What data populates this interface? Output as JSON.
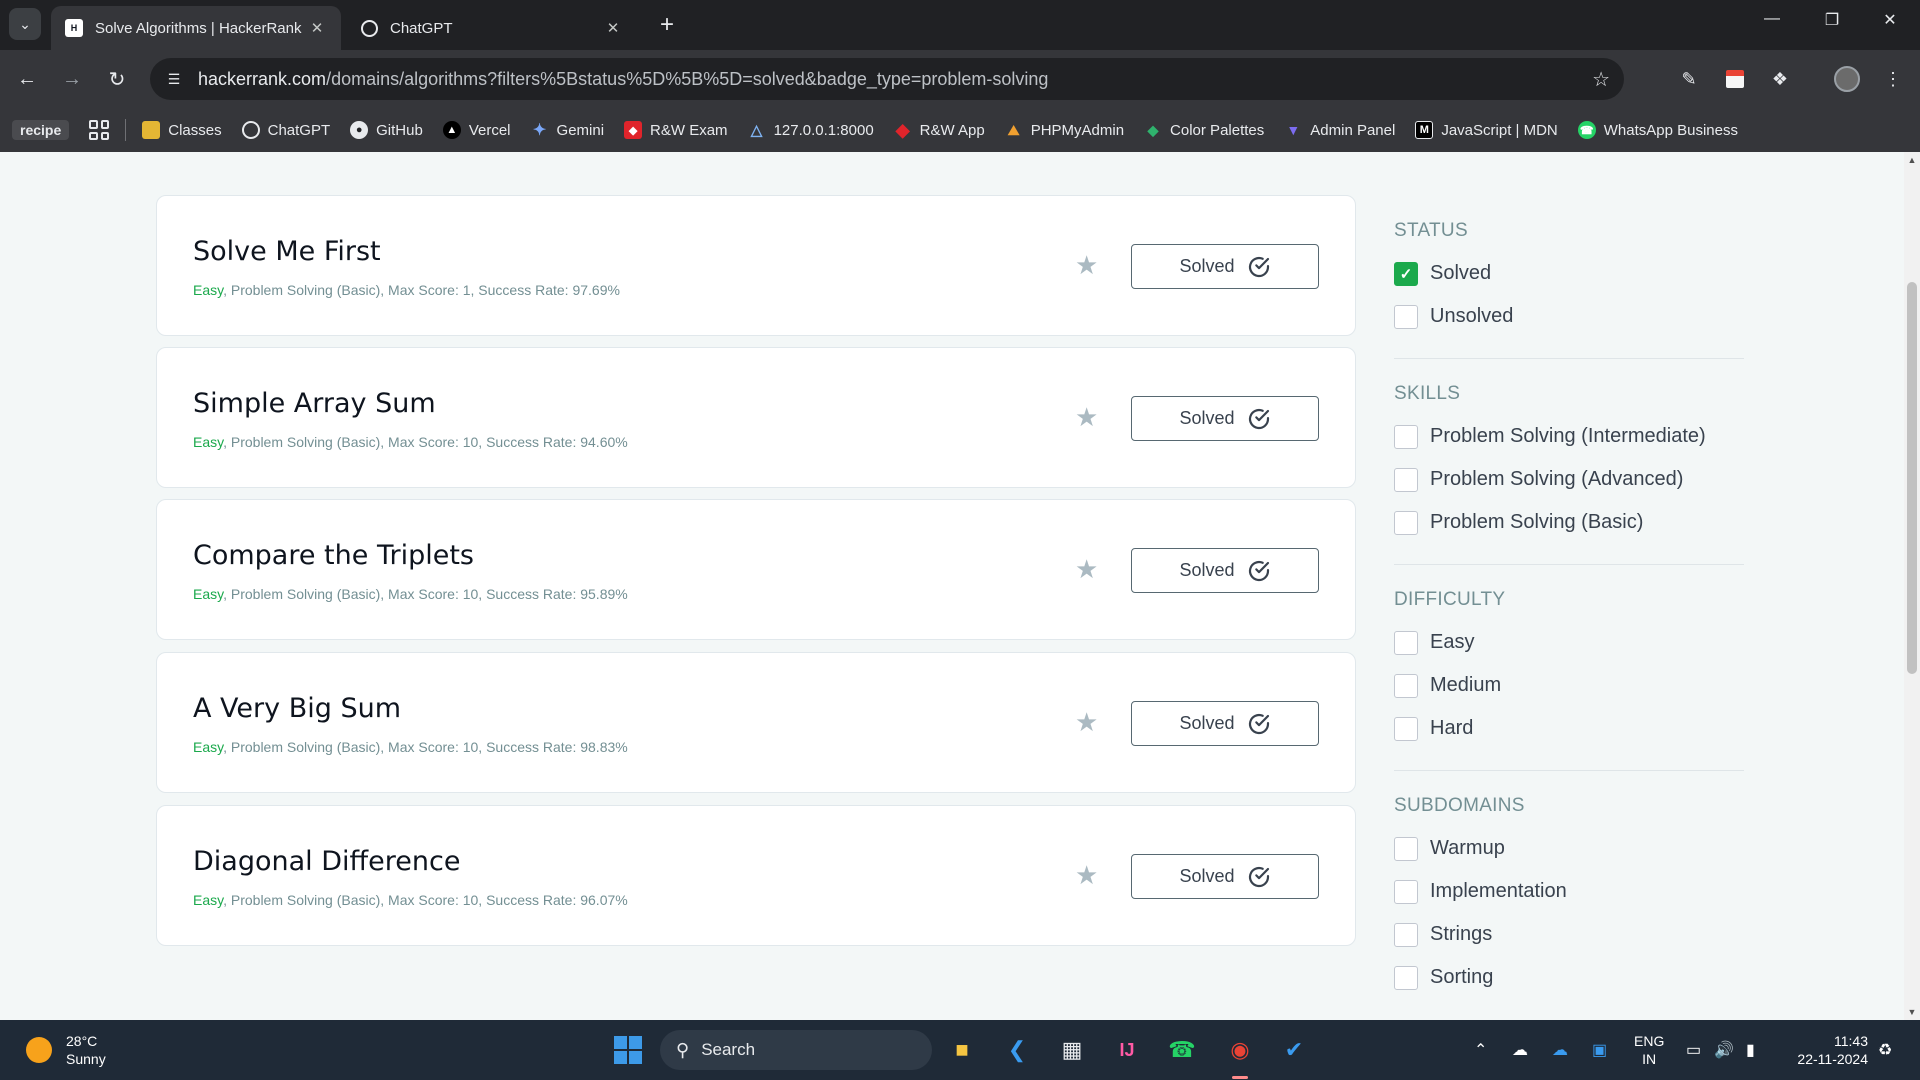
{
  "browser": {
    "tabs": [
      {
        "title": "Solve Algorithms | HackerRank",
        "active": true
      },
      {
        "title": "ChatGPT",
        "active": false
      }
    ],
    "url_host": "hackerrank.com",
    "url_path": "/domains/algorithms?filters%5Bstatus%5D%5B%5D=solved&badge_type=problem-solving",
    "bookmarks": [
      "recipe",
      "Classes",
      "ChatGPT",
      "GitHub",
      "Vercel",
      "Gemini",
      "R&W Exam",
      "127.0.0.1:8000",
      "R&W App",
      "PHPMyAdmin",
      "Color Palettes",
      "Admin Panel",
      "JavaScript | MDN",
      "WhatsApp Business"
    ]
  },
  "challenges": [
    {
      "title": "Solve Me First",
      "difficulty": "Easy",
      "meta": ", Problem Solving (Basic), Max Score: 1, Success Rate: 97.69%",
      "status": "Solved"
    },
    {
      "title": "Simple Array Sum",
      "difficulty": "Easy",
      "meta": ", Problem Solving (Basic), Max Score: 10, Success Rate: 94.60%",
      "status": "Solved"
    },
    {
      "title": "Compare the Triplets",
      "difficulty": "Easy",
      "meta": ", Problem Solving (Basic), Max Score: 10, Success Rate: 95.89%",
      "status": "Solved"
    },
    {
      "title": "A Very Big Sum",
      "difficulty": "Easy",
      "meta": ", Problem Solving (Basic), Max Score: 10, Success Rate: 98.83%",
      "status": "Solved"
    },
    {
      "title": "Diagonal Difference",
      "difficulty": "Easy",
      "meta": ", Problem Solving (Basic), Max Score: 10, Success Rate: 96.07%",
      "status": "Solved"
    }
  ],
  "filters": {
    "status": {
      "heading": "STATUS",
      "items": [
        {
          "label": "Solved",
          "checked": true
        },
        {
          "label": "Unsolved",
          "checked": false
        }
      ]
    },
    "skills": {
      "heading": "SKILLS",
      "items": [
        {
          "label": "Problem Solving (Intermediate)"
        },
        {
          "label": "Problem Solving (Advanced)"
        },
        {
          "label": "Problem Solving (Basic)"
        }
      ]
    },
    "difficulty": {
      "heading": "DIFFICULTY",
      "items": [
        {
          "label": "Easy"
        },
        {
          "label": "Medium"
        },
        {
          "label": "Hard"
        }
      ]
    },
    "subdomains": {
      "heading": "SUBDOMAINS",
      "items": [
        {
          "label": "Warmup"
        },
        {
          "label": "Implementation"
        },
        {
          "label": "Strings"
        },
        {
          "label": "Sorting"
        }
      ]
    }
  },
  "taskbar": {
    "temperature": "28°C",
    "condition": "Sunny",
    "search_label": "Search",
    "lang_line1": "ENG",
    "lang_line2": "IN",
    "time": "11:43",
    "date": "22-11-2024"
  },
  "colors": {
    "easy": "#1ba94c",
    "checkbox_checked": "#1ba94c",
    "chrome_dark": "#202124",
    "taskbar": "#1f2a37"
  }
}
